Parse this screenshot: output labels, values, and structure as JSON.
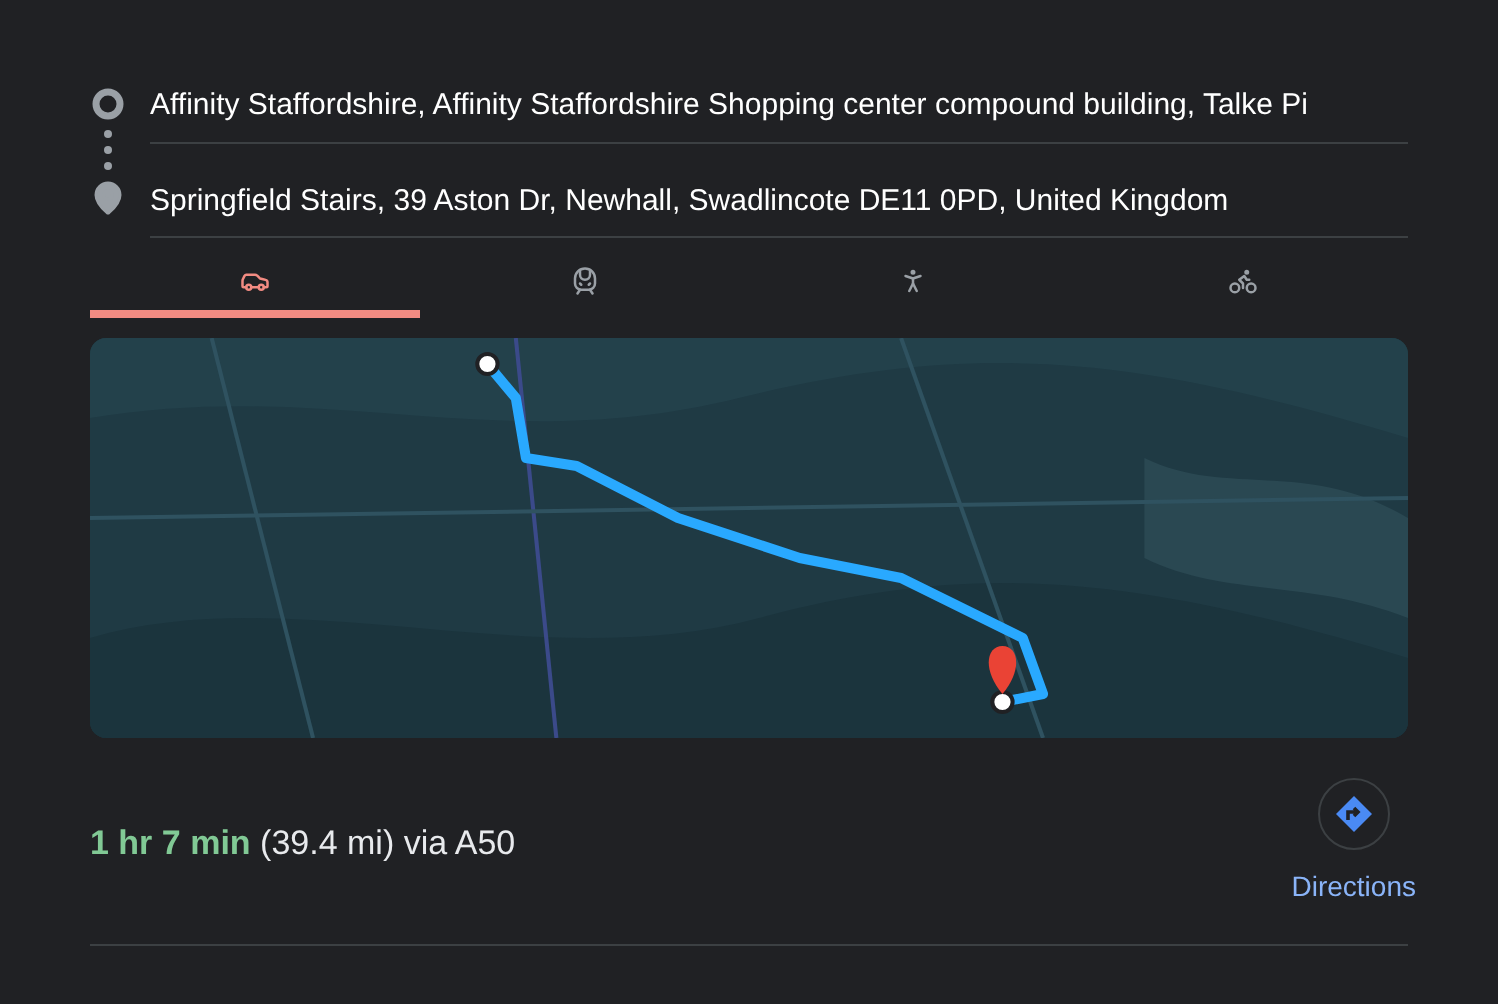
{
  "origin": {
    "value": "Affinity Staffordshire, Affinity Staffordshire Shopping center compound building, Talke Pi"
  },
  "destination": {
    "value": "Springfield Stairs, 39 Aston Dr, Newhall, Swadlincote DE11 0PD, United Kingdom"
  },
  "travel_modes": [
    {
      "kind": "car",
      "selected": true
    },
    {
      "kind": "train",
      "selected": false
    },
    {
      "kind": "walk",
      "selected": false
    },
    {
      "kind": "bike",
      "selected": false
    }
  ],
  "route": {
    "duration": "1 hr 7 min",
    "details": "(39.4 mi) via A50"
  },
  "directions_button": {
    "label": "Directions"
  }
}
